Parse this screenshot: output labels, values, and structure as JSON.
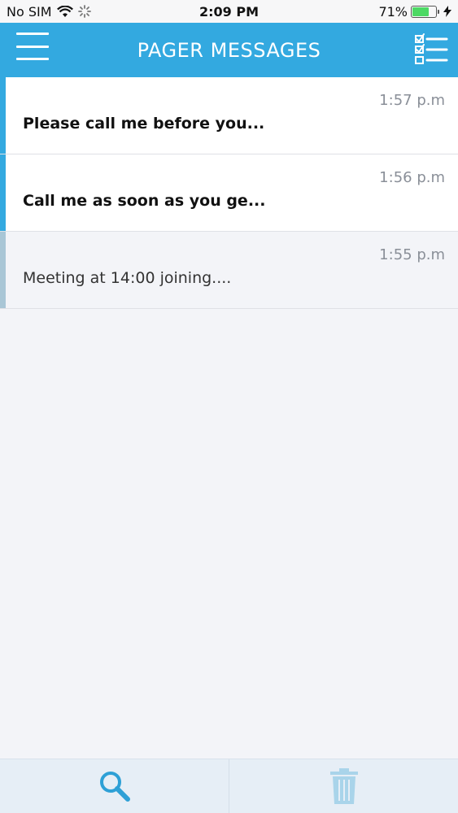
{
  "status_bar": {
    "carrier": "No SIM",
    "time": "2:09 PM",
    "battery_percent": "71%",
    "battery_level": 0.71,
    "icons": [
      "wifi-icon",
      "activity-spinner-icon",
      "battery-icon",
      "charging-bolt-icon"
    ]
  },
  "header": {
    "title": "PAGER MESSAGES",
    "left_icon": "menu-icon",
    "right_icon": "checklist-icon"
  },
  "messages": [
    {
      "time": "1:57 p.m",
      "text": "Please call me before you...",
      "unread": true
    },
    {
      "time": "1:56 p.m",
      "text": "Call me as soon as you ge...",
      "unread": true
    },
    {
      "time": "1:55 p.m",
      "text": "Meeting at 14:00 joining....",
      "unread": false
    }
  ],
  "toolbar": {
    "items": [
      "search-icon",
      "trash-icon"
    ]
  },
  "colors": {
    "accent": "#33a9e0",
    "read_accent": "#a9c6d6",
    "background": "#f3f4f8",
    "toolbar_icon_active": "#2ea0d6",
    "toolbar_icon_muted": "#a9d4ea"
  }
}
